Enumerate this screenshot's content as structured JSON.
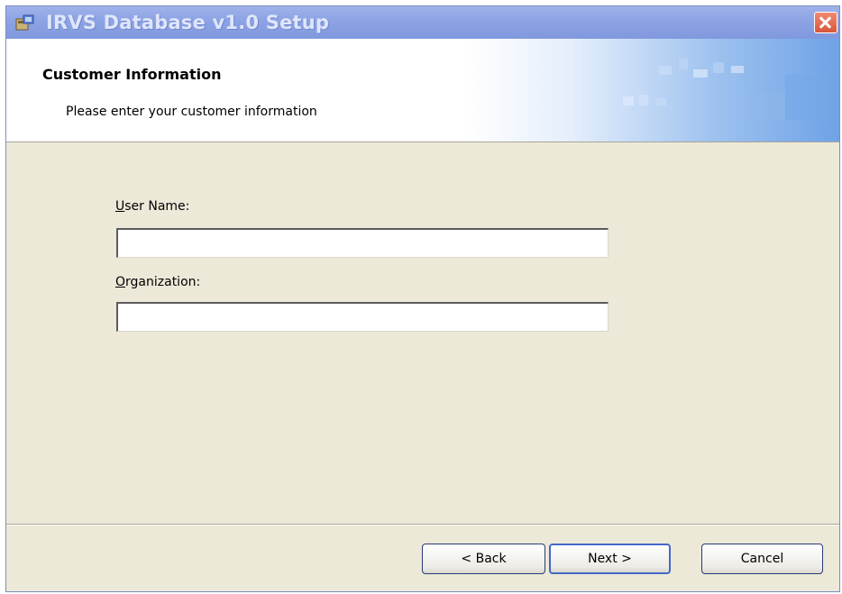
{
  "window": {
    "title": "IRVS Database v1.0 Setup"
  },
  "banner": {
    "title": "Customer Information",
    "subtitle": "Please enter your customer information"
  },
  "form": {
    "user_name": {
      "mnemonic": "U",
      "label_rest": "ser Name:",
      "value": ""
    },
    "organization": {
      "mnemonic": "O",
      "label_rest": "rganization:",
      "value": ""
    }
  },
  "buttons": {
    "back": "< Back",
    "next": "Next >",
    "cancel": "Cancel"
  },
  "icons": {
    "title": "installer-icon",
    "close": "close-icon"
  },
  "colors": {
    "dialog_bg": "#ECE9D8",
    "titlebar": "#8EA4E4",
    "close": "#D8553A",
    "default_button_border": "#4468C8"
  }
}
